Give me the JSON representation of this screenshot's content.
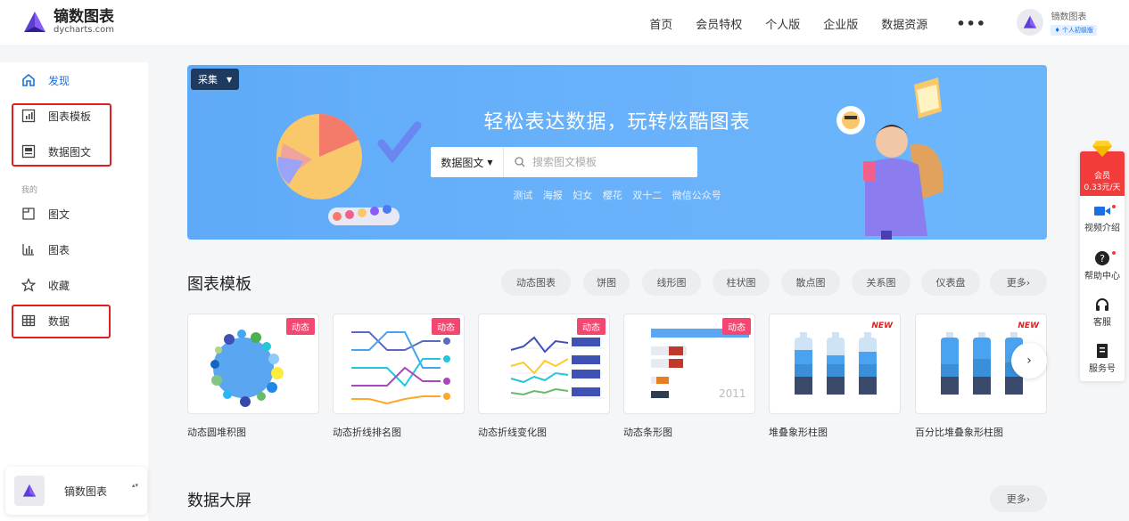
{
  "brand": {
    "name_cn": "镝数图表",
    "name_en": "dycharts.com"
  },
  "nav": {
    "items": [
      "首页",
      "会员特权",
      "个人版",
      "企业版",
      "数据资源"
    ],
    "more": "•••"
  },
  "user": {
    "name": "镝数图表",
    "badge": "个人初级版"
  },
  "sidebar": {
    "discover": "发现",
    "chart_templates": "图表模板",
    "data_graphics": "数据图文",
    "section_mine": "我的",
    "graphics": "图文",
    "charts": "图表",
    "favorites": "收藏",
    "data": "数据",
    "switch_name": "镝数图表",
    "switch_arrows": "▴▾"
  },
  "banner": {
    "collect": "采集",
    "title": "轻松表达数据，玩转炫酷图表",
    "search_type": "数据图文",
    "search_placeholder": "搜索图文模板",
    "hot_tags": [
      "测试",
      "海报",
      "妇女",
      "樱花",
      "双十二",
      "微信公众号"
    ]
  },
  "templates": {
    "title": "图表模板",
    "filters": [
      "动态图表",
      "饼图",
      "线形图",
      "柱状图",
      "散点图",
      "关系图",
      "仪表盘",
      "更多›"
    ],
    "cards": [
      {
        "label": "动态圆堆积图",
        "tag": "动态"
      },
      {
        "label": "动态折线排名图",
        "tag": "动态"
      },
      {
        "label": "动态折线变化图",
        "tag": "动态"
      },
      {
        "label": "动态条形图",
        "tag": "动态",
        "year": "2011"
      },
      {
        "label": "堆叠象形柱图",
        "tag": "NEW"
      },
      {
        "label": "百分比堆叠象形柱图",
        "tag": "NEW"
      }
    ],
    "next": "›"
  },
  "bigscreen": {
    "title": "数据大屏",
    "more": "更多›"
  },
  "float_panel": {
    "vip_label": "会员",
    "vip_price": "0.33元/天",
    "video": "视频介绍",
    "help": "帮助中心",
    "service": "客服",
    "account": "服务号"
  },
  "colors": {
    "accent": "#1b6fe0",
    "banner": "#66b1fb",
    "tag_red": "#f24770",
    "highlight_box": "#e11d1d"
  }
}
